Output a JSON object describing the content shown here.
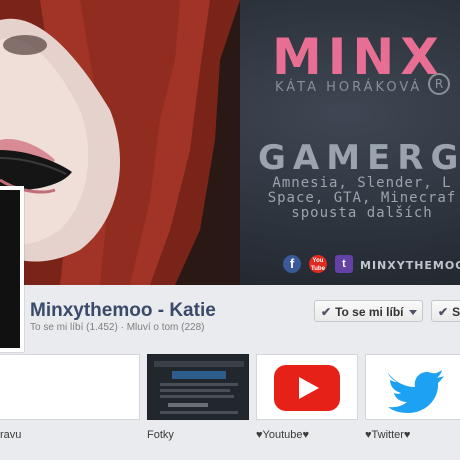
{
  "cover": {
    "brand_title": "MINX",
    "brand_subtitle": "KÁTA HORÁKOVÁ",
    "registered_mark": "R",
    "gamer_heading": "GAMERG",
    "games_lines": [
      "Amnesia, Slender, L",
      "Space, GTA, Minecraf",
      "spousta dalších"
    ],
    "social_icons": [
      {
        "name": "facebook-icon",
        "glyph": "f",
        "color": "#3b5998"
      },
      {
        "name": "youtube-icon",
        "glyph": "You Tube",
        "color": "#e02a20"
      },
      {
        "name": "twitch-icon",
        "glyph": "t",
        "color": "#6441a5"
      }
    ],
    "handle": "MINXYTHEMOOOF"
  },
  "page": {
    "name": "Minxythemoo - Katie",
    "meta": "To se mi líbí (1.452) · Mluví o tom (228)"
  },
  "actions": {
    "like_check": "✔",
    "like_label": "To se mi líbí",
    "second_check": "✔",
    "second_label": "S"
  },
  "tiles": [
    {
      "label": "ravu"
    },
    {
      "label": "Fotky"
    },
    {
      "label": "♥Youtube♥"
    },
    {
      "label": "♥Twitter♥"
    }
  ],
  "colors": {
    "accent_pink": "#e86f93",
    "facebook_blue": "#3b5998",
    "youtube_red": "#e02a20",
    "twitter_blue": "#1da1f2"
  }
}
